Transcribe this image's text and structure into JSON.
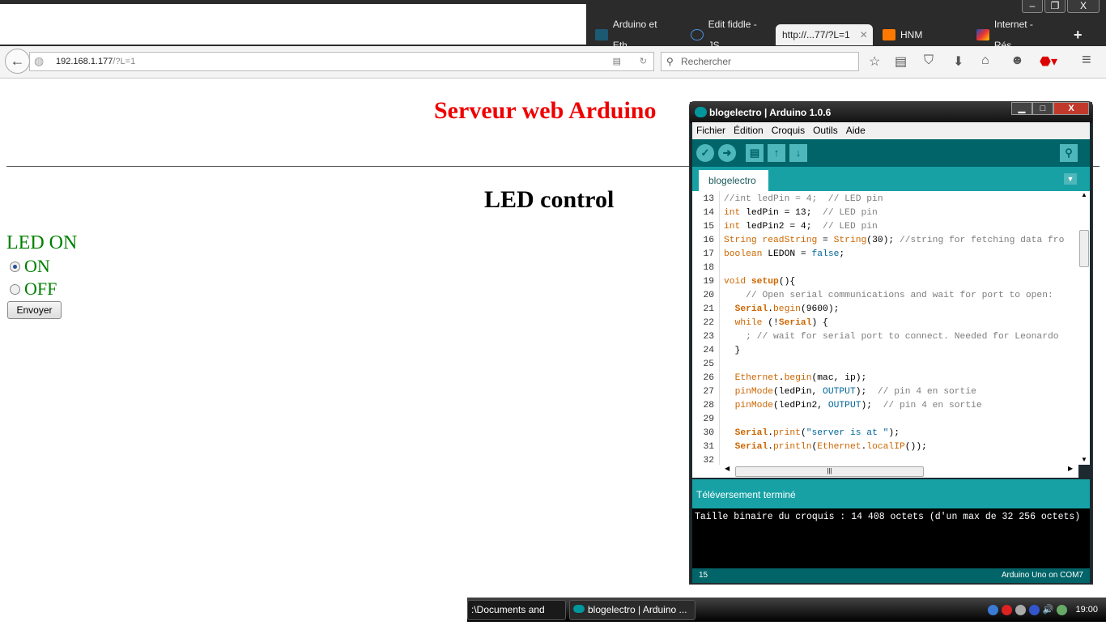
{
  "browser": {
    "tabs": [
      {
        "label": "Arduino et Eth...",
        "icon": "arduino-icon"
      },
      {
        "label": "Edit fiddle - JS...",
        "icon": "jsfiddle-icon"
      },
      {
        "label": "http://...77/?L=1",
        "icon": "",
        "active": true
      },
      {
        "label": "HNM",
        "icon": "orange-icon"
      },
      {
        "label": "Internet - Rés...",
        "icon": "internet-icon"
      }
    ],
    "new_tab": "+",
    "url_host": "192.168.1.177",
    "url_path": "/?L=1",
    "search_placeholder": "Rechercher"
  },
  "page": {
    "title": "Serveur web Arduino",
    "subtitle": "LED control",
    "status": "LED ON",
    "options": [
      {
        "label": "ON",
        "checked": true
      },
      {
        "label": "OFF",
        "checked": false
      }
    ],
    "submit": "Envoyer"
  },
  "ide": {
    "title": "blogelectro | Arduino 1.0.6",
    "menu": [
      "Fichier",
      "Édition",
      "Croquis",
      "Outils",
      "Aide"
    ],
    "tab": "blogelectro",
    "code": [
      {
        "n": "13",
        "s": [
          [
            "//int ledPin = 4;  // LED pin",
            "cm"
          ]
        ]
      },
      {
        "n": "14",
        "s": [
          [
            "int",
            "kw"
          ],
          [
            " ledPin = 13;  ",
            "pl"
          ],
          [
            "// LED pin",
            "cm"
          ]
        ]
      },
      {
        "n": "15",
        "s": [
          [
            "int",
            "kw"
          ],
          [
            " ledPin2 = 4;  ",
            "pl"
          ],
          [
            "// LED pin",
            "cm"
          ]
        ]
      },
      {
        "n": "16",
        "s": [
          [
            "String",
            "kw"
          ],
          [
            " ",
            "pl"
          ],
          [
            "readString",
            "kw"
          ],
          [
            " = ",
            "pl"
          ],
          [
            "String",
            "kw"
          ],
          [
            "(30); ",
            "pl"
          ],
          [
            "//string for fetching data fro",
            "cm"
          ]
        ]
      },
      {
        "n": "17",
        "s": [
          [
            "boolean",
            "kw"
          ],
          [
            " LEDON = ",
            "pl"
          ],
          [
            "false",
            "cst"
          ],
          [
            ";",
            "pl"
          ]
        ]
      },
      {
        "n": "18",
        "s": []
      },
      {
        "n": "19",
        "s": [
          [
            "void",
            "kw"
          ],
          [
            " ",
            "pl"
          ],
          [
            "setup",
            "kwb"
          ],
          [
            "(){",
            "pl"
          ]
        ]
      },
      {
        "n": "20",
        "s": [
          [
            "    // Open serial communications and wait for port to open:",
            "cm"
          ]
        ]
      },
      {
        "n": "21",
        "s": [
          [
            "  ",
            "pl"
          ],
          [
            "Serial",
            "kwb"
          ],
          [
            ".",
            "pl"
          ],
          [
            "begin",
            "kw"
          ],
          [
            "(9600);",
            "pl"
          ]
        ]
      },
      {
        "n": "22",
        "s": [
          [
            "  ",
            "pl"
          ],
          [
            "while",
            "kw"
          ],
          [
            " (!",
            "pl"
          ],
          [
            "Serial",
            "kwb"
          ],
          [
            ") {",
            "pl"
          ]
        ]
      },
      {
        "n": "23",
        "s": [
          [
            "    ; // wait for serial port to connect. Needed for Leonardo",
            "cm"
          ]
        ]
      },
      {
        "n": "24",
        "s": [
          [
            "  }",
            "pl"
          ]
        ]
      },
      {
        "n": "25",
        "s": []
      },
      {
        "n": "26",
        "s": [
          [
            "  ",
            "pl"
          ],
          [
            "Ethernet",
            "kw"
          ],
          [
            ".",
            "pl"
          ],
          [
            "begin",
            "kw"
          ],
          [
            "(mac, ip);",
            "pl"
          ]
        ]
      },
      {
        "n": "27",
        "s": [
          [
            "  ",
            "pl"
          ],
          [
            "pinMode",
            "kw"
          ],
          [
            "(ledPin, ",
            "pl"
          ],
          [
            "OUTPUT",
            "cst"
          ],
          [
            ");  ",
            "pl"
          ],
          [
            "// pin 4 en sortie",
            "cm"
          ]
        ]
      },
      {
        "n": "28",
        "s": [
          [
            "  ",
            "pl"
          ],
          [
            "pinMode",
            "kw"
          ],
          [
            "(ledPin2, ",
            "pl"
          ],
          [
            "OUTPUT",
            "cst"
          ],
          [
            ");  ",
            "pl"
          ],
          [
            "// pin 4 en sortie",
            "cm"
          ]
        ]
      },
      {
        "n": "29",
        "s": []
      },
      {
        "n": "30",
        "s": [
          [
            "  ",
            "pl"
          ],
          [
            "Serial",
            "kwb"
          ],
          [
            ".",
            "pl"
          ],
          [
            "print",
            "kw"
          ],
          [
            "(",
            "pl"
          ],
          [
            "\"server is at \"",
            "cst"
          ],
          [
            ");",
            "pl"
          ]
        ]
      },
      {
        "n": "31",
        "s": [
          [
            "  ",
            "pl"
          ],
          [
            "Serial",
            "kwb"
          ],
          [
            ".",
            "pl"
          ],
          [
            "println",
            "kw"
          ],
          [
            "(",
            "pl"
          ],
          [
            "Ethernet",
            "kw"
          ],
          [
            ".",
            "pl"
          ],
          [
            "localIP",
            "kw"
          ],
          [
            "());",
            "pl"
          ]
        ]
      },
      {
        "n": "32",
        "s": []
      }
    ],
    "status": "Téléversement terminé",
    "console": "Taille binaire du croquis : 14 408 octets (d'un max de 32 256 octets)",
    "footer_line": "15",
    "footer_board": "Arduino Uno on COM7"
  },
  "taskbar": {
    "items": [
      ":\\Documents and Set...",
      "blogelectro | Arduino ..."
    ],
    "clock": "19:00"
  },
  "colors": {
    "teal_dark": "#006468",
    "teal": "#17a1a5",
    "title_red": "#ee0000",
    "led_green": "#008000"
  }
}
